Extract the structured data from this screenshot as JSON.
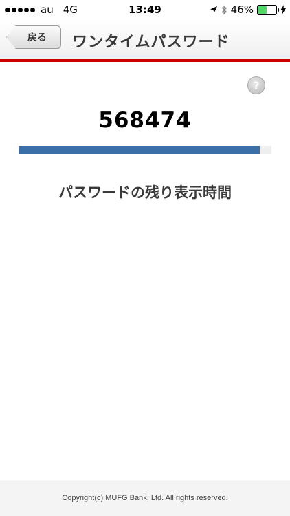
{
  "status_bar": {
    "carrier": "au",
    "network": "4G",
    "time": "13:49",
    "battery_percent": "46%",
    "battery_level": 0.46
  },
  "nav": {
    "back_label": "戻る",
    "title": "ワンタイムパスワード"
  },
  "help": {
    "symbol": "?"
  },
  "otp": {
    "code": "568474",
    "remaining_fraction": 0.955,
    "bar_color": "#3a6fa8",
    "label": "パスワードの残り表示時間"
  },
  "footer": {
    "copyright": "Copyright(c) MUFG Bank, Ltd. All rights reserved."
  },
  "colors": {
    "accent_red": "#cc0000",
    "battery_green": "#4cd964"
  }
}
